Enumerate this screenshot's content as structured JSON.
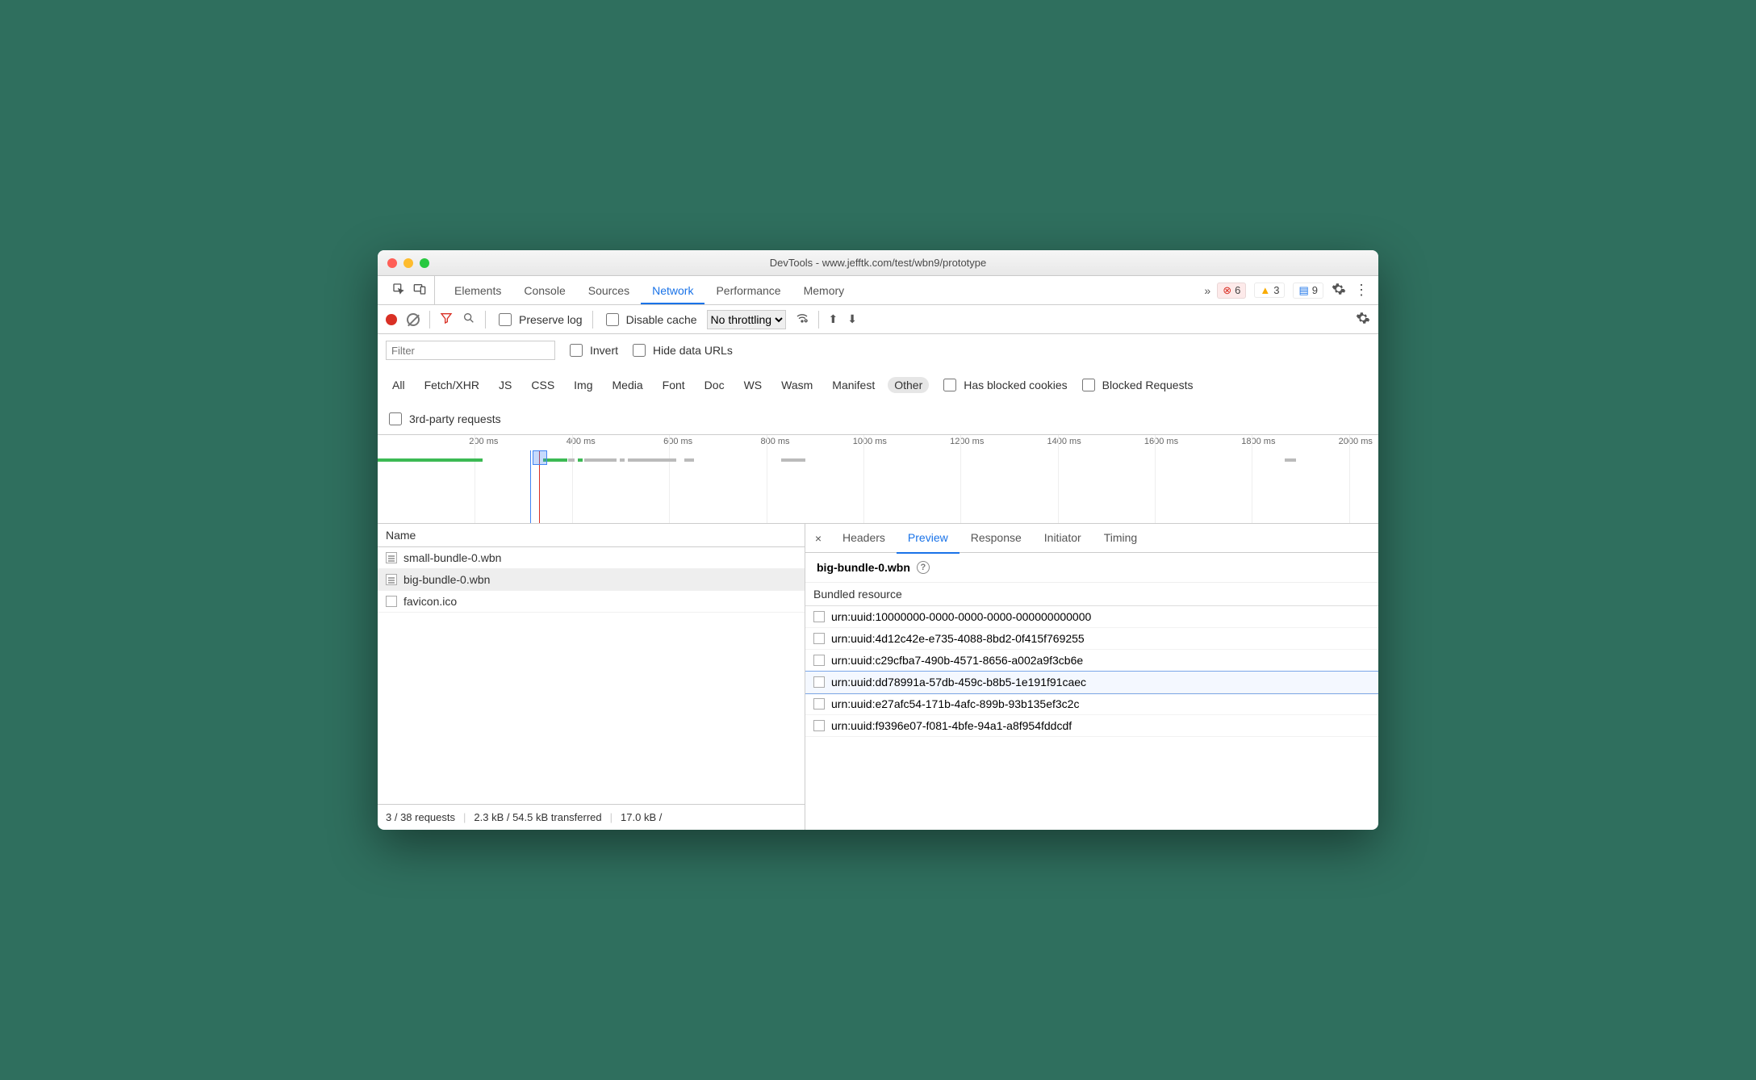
{
  "window": {
    "title": "DevTools - www.jefftk.com/test/wbn9/prototype"
  },
  "main_tabs": {
    "items": [
      "Elements",
      "Console",
      "Sources",
      "Network",
      "Performance",
      "Memory"
    ],
    "active": "Network"
  },
  "badges": {
    "errors": 6,
    "warnings": 3,
    "messages": 9
  },
  "bar2": {
    "preserve_log": "Preserve log",
    "disable_cache": "Disable cache",
    "no_throttling": "No throttling"
  },
  "bar3": {
    "filter_placeholder": "Filter",
    "invert": "Invert",
    "hide_data_urls": "Hide data URLs",
    "types": [
      "All",
      "Fetch/XHR",
      "JS",
      "CSS",
      "Img",
      "Media",
      "Font",
      "Doc",
      "WS",
      "Wasm",
      "Manifest",
      "Other"
    ],
    "type_selected": "Other",
    "has_blocked_cookies": "Has blocked cookies",
    "blocked_requests": "Blocked Requests",
    "third_party": "3rd-party requests"
  },
  "timeline": {
    "ticks": [
      "200 ms",
      "400 ms",
      "600 ms",
      "800 ms",
      "1000 ms",
      "1200 ms",
      "1400 ms",
      "1600 ms",
      "1800 ms",
      "2000 ms"
    ]
  },
  "left": {
    "header": "Name",
    "rows": [
      "small-bundle-0.wbn",
      "big-bundle-0.wbn",
      "favicon.ico"
    ],
    "selected_index": 1
  },
  "status": {
    "a": "3 / 38 requests",
    "b": "2.3 kB / 54.5 kB transferred",
    "c": "17.0 kB /"
  },
  "detail_tabs": {
    "items": [
      "Headers",
      "Preview",
      "Response",
      "Initiator",
      "Timing"
    ],
    "active": "Preview"
  },
  "preview": {
    "resource_name": "big-bundle-0.wbn",
    "section": "Bundled resource",
    "items": [
      "urn:uuid:10000000-0000-0000-0000-000000000000",
      "urn:uuid:4d12c42e-e735-4088-8bd2-0f415f769255",
      "urn:uuid:c29cfba7-490b-4571-8656-a002a9f3cb6e",
      "urn:uuid:dd78991a-57db-459c-b8b5-1e191f91caec",
      "urn:uuid:e27afc54-171b-4afc-899b-93b135ef3c2c",
      "urn:uuid:f9396e07-f081-4bfe-94a1-a8f954fddcdf"
    ],
    "selected_index": 3
  }
}
